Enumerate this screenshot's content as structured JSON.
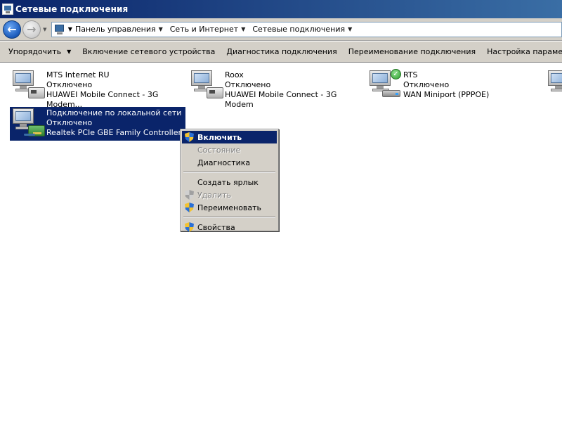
{
  "window": {
    "title": "Сетевые подключения"
  },
  "address": {
    "breadcrumbs": [
      "Панель управления",
      "Сеть и Интернет",
      "Сетевые подключения"
    ]
  },
  "toolbar": {
    "organize": "Упорядочить",
    "enable_device": "Включение сетевого устройства",
    "diagnose": "Диагностика подключения",
    "rename": "Переименование подключения",
    "settings": "Настройка параметров подключе"
  },
  "connections": [
    {
      "name": "MTS Internet RU",
      "status": "Отключено",
      "device": "HUAWEI Mobile Connect - 3G Modem..."
    },
    {
      "name": "Roox",
      "status": "Отключено",
      "device": "HUAWEI Mobile Connect - 3G Modem"
    },
    {
      "name": "RTS",
      "status": "Отключено",
      "device": "WAN Miniport (PPPOE)"
    },
    {
      "name": "Подключение по локальной сети",
      "status": "Отключено",
      "device": "Realtek PCIe GBE Family Controller"
    }
  ],
  "context_menu": {
    "enable": "Включить",
    "status": "Состояние",
    "diagnose": "Диагностика",
    "shortcut": "Создать ярлык",
    "delete": "Удалить",
    "rename": "Переименовать",
    "properties": "Свойства"
  },
  "icons": {
    "back": "back-arrow-icon",
    "forward": "forward-arrow-icon",
    "shield": "uac-shield-icon",
    "check": "connected-check-icon"
  }
}
